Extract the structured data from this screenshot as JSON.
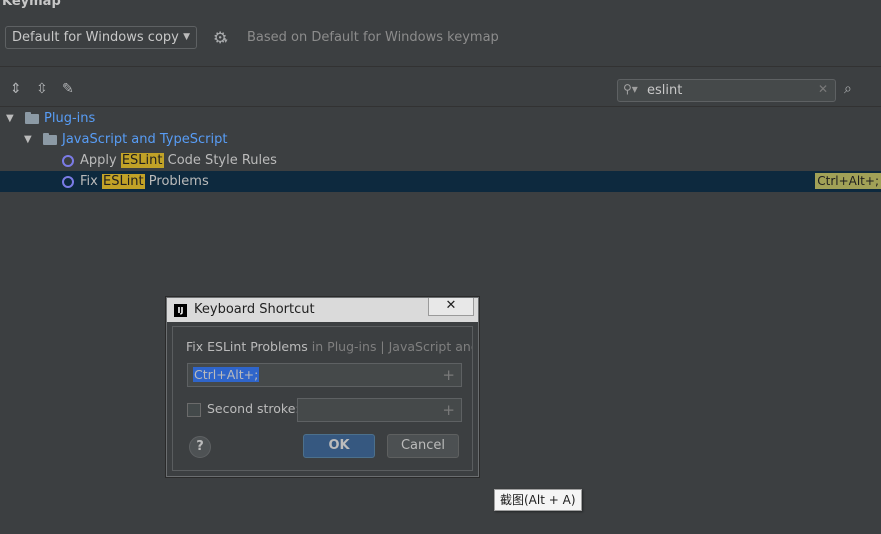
{
  "header": {
    "title": "Keymap",
    "keymap_select": "Default for Windows copy",
    "based_on": "Based on Default for Windows keymap"
  },
  "toolbar": {
    "icons": [
      "expand-all-icon",
      "collapse-all-icon",
      "edit-icon"
    ],
    "search_value": "eslint",
    "find_by_shortcut_icon": "find-by-shortcut-icon"
  },
  "tree": {
    "plugins_label": "Plug-ins",
    "group_label": "JavaScript and TypeScript",
    "items": [
      {
        "prefix": "Apply ",
        "highlight": "ESLint",
        "suffix": " Code Style Rules",
        "shortcut": ""
      },
      {
        "prefix": "Fix ",
        "highlight": "ESLint",
        "suffix": " Problems",
        "shortcut": "Ctrl+Alt+;"
      }
    ]
  },
  "dialog": {
    "title": "Keyboard Shortcut",
    "close_glyph": "✕",
    "action_name": "Fix ESLint Problems",
    "action_context": "in Plug-ins | JavaScript and TypeScript",
    "shortcut_value": "Ctrl+Alt+;",
    "second_stroke_label": "Second stroke:",
    "help_glyph": "?",
    "ok_label": "OK",
    "cancel_label": "Cancel"
  },
  "tooltip": "截图(Alt + A)",
  "colors": {
    "background": "#3c3f41",
    "link_blue": "#589df6",
    "search_highlight": "#c1a227",
    "selection": "#0d293e",
    "ok_button": "#365880"
  }
}
